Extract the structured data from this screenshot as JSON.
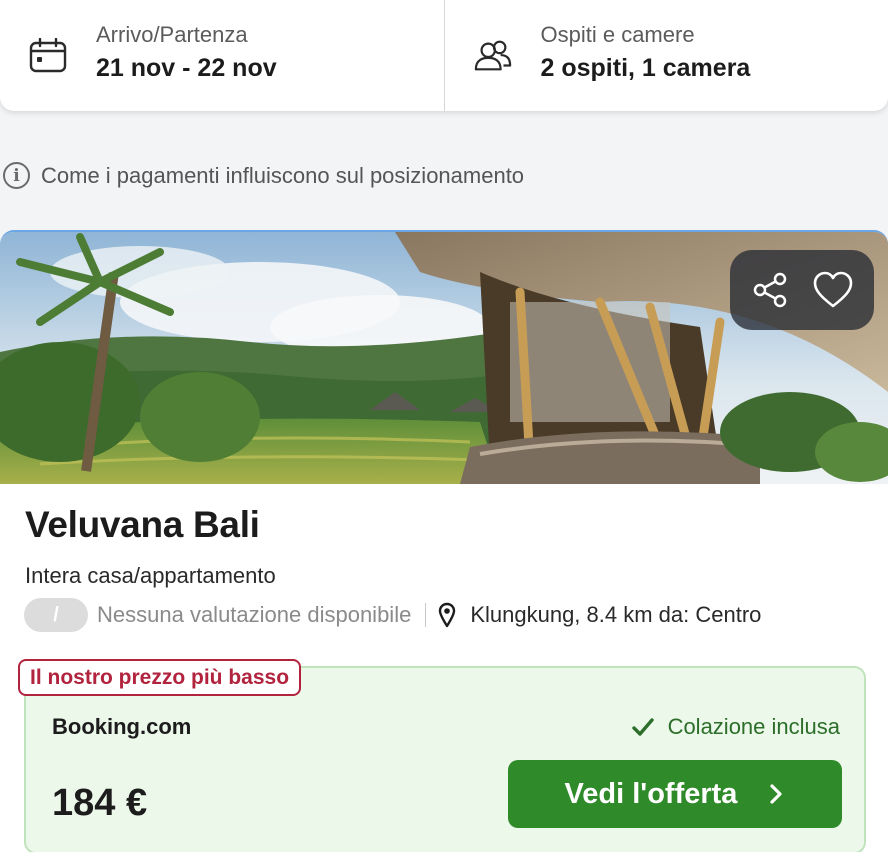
{
  "search": {
    "dates_label": "Arrivo/Partenza",
    "dates_value": "21 nov - 22 nov",
    "guests_label": "Ospiti e camere",
    "guests_value": "2 ospiti, 1 camera"
  },
  "payment_info": {
    "text": "Come i pagamenti influiscono sul posizionamento",
    "icon": "info-icon"
  },
  "hotel": {
    "name": "Veluvana Bali",
    "type": "Intera casa/appartamento",
    "rating_badge": "/",
    "rating_text": "Nessuna valutazione disponibile",
    "location": "Klungkung, 8.4 km da: Centro",
    "actions": [
      "share-icon",
      "heart-icon"
    ]
  },
  "deal": {
    "badge": "Il nostro prezzo più basso",
    "provider": "Booking.com",
    "breakfast": "Colazione inclusa",
    "price": "184 €",
    "button_label": "Vedi l'offerta"
  },
  "colors": {
    "accent_green": "#2f8a2a",
    "deal_background": "#ecf8ea",
    "badge_red": "#b2233e"
  }
}
